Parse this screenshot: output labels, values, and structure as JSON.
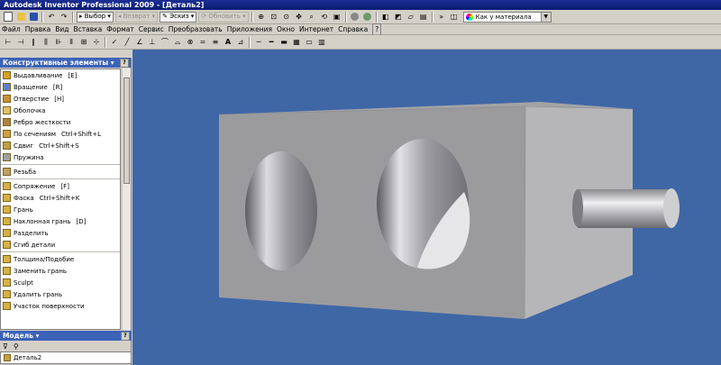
{
  "window": {
    "title": "Autodesk Inventor Professional 2009 - [Деталь2]"
  },
  "toolbar1": {
    "select_label": "Выбор",
    "return_label": "Возврат",
    "sketch_label": "Эскиз",
    "update_label": "Обновить",
    "material_value": "Как у материала"
  },
  "menubar": {
    "items": [
      "Файл",
      "Правка",
      "Вид",
      "Вставка",
      "Формат",
      "Сервис",
      "Преобразовать",
      "Приложения",
      "Окно",
      "Интернет",
      "Справка"
    ]
  },
  "features_panel": {
    "title": "Конструктивные элементы ▾",
    "help": "?",
    "items": [
      {
        "label": "Выдавливание",
        "shortcut": "[E]",
        "icon": "extrude-icon"
      },
      {
        "label": "Вращение",
        "shortcut": "[R]",
        "icon": "revolve-icon"
      },
      {
        "label": "Отверстие",
        "shortcut": "[H]",
        "icon": "hole-icon"
      },
      {
        "label": "Оболочка",
        "shortcut": "",
        "icon": "shell-icon"
      },
      {
        "label": "Ребро жесткости",
        "shortcut": "",
        "icon": "rib-icon"
      },
      {
        "label": "По сечениям",
        "shortcut": "Ctrl+Shift+L",
        "icon": "loft-icon"
      },
      {
        "label": "Сдвиг",
        "shortcut": "Ctrl+Shift+S",
        "icon": "sweep-icon"
      },
      {
        "label": "Пружина",
        "shortcut": "",
        "icon": "coil-icon"
      },
      {
        "label": "Резьба",
        "shortcut": "",
        "icon": "thread-icon"
      },
      {
        "label": "Сопряжение",
        "shortcut": "[F]",
        "icon": "fillet-icon"
      },
      {
        "label": "Фаска",
        "shortcut": "Ctrl+Shift+K",
        "icon": "chamfer-icon"
      },
      {
        "label": "Грань",
        "shortcut": "",
        "icon": "face-icon"
      },
      {
        "label": "Наклонная грань",
        "shortcut": "[D]",
        "icon": "face-draft-icon"
      },
      {
        "label": "Разделить",
        "shortcut": "",
        "icon": "split-icon"
      },
      {
        "label": "Сгиб детали",
        "shortcut": "",
        "icon": "bend-part-icon"
      },
      {
        "label": "Толщина/Подобие",
        "shortcut": "",
        "icon": "thicken-icon"
      },
      {
        "label": "Заменить грань",
        "shortcut": "",
        "icon": "replace-face-icon"
      },
      {
        "label": "Sculpt",
        "shortcut": "",
        "icon": "sculpt-icon"
      },
      {
        "label": "Удалить грань",
        "shortcut": "",
        "icon": "delete-face-icon"
      },
      {
        "label": "Участок поверхности",
        "shortcut": "",
        "icon": "boundary-patch-icon"
      }
    ]
  },
  "model_panel": {
    "title": "Модель ▾",
    "help": "?",
    "root": "Деталь2"
  },
  "colors": {
    "viewport_bg": "#3f67a6",
    "part_front": "#9a9a9c",
    "part_top": "#a4a4a6",
    "part_side": "#b9b9bb"
  }
}
